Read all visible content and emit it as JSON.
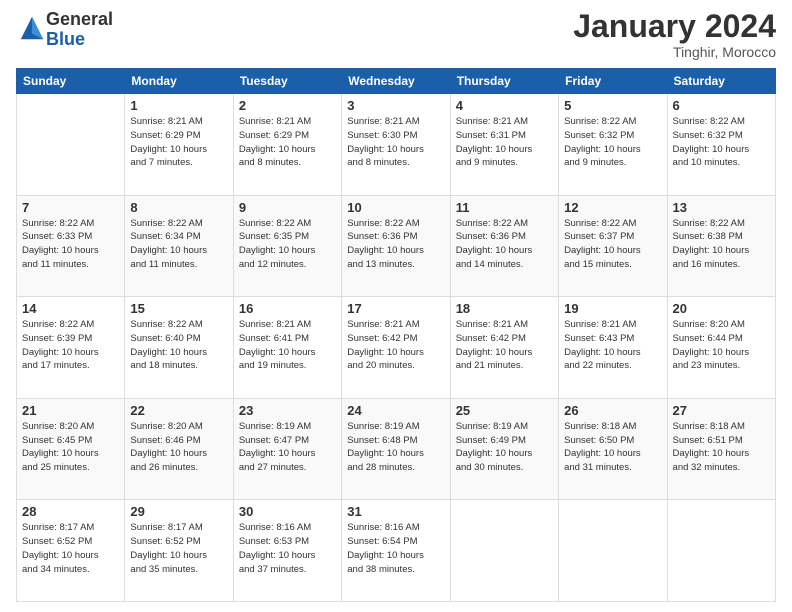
{
  "header": {
    "logo_general": "General",
    "logo_blue": "Blue",
    "month_title": "January 2024",
    "location": "Tinghir, Morocco"
  },
  "calendar": {
    "days_of_week": [
      "Sunday",
      "Monday",
      "Tuesday",
      "Wednesday",
      "Thursday",
      "Friday",
      "Saturday"
    ],
    "weeks": [
      [
        {
          "day": "",
          "info": ""
        },
        {
          "day": "1",
          "info": "Sunrise: 8:21 AM\nSunset: 6:29 PM\nDaylight: 10 hours\nand 7 minutes."
        },
        {
          "day": "2",
          "info": "Sunrise: 8:21 AM\nSunset: 6:29 PM\nDaylight: 10 hours\nand 8 minutes."
        },
        {
          "day": "3",
          "info": "Sunrise: 8:21 AM\nSunset: 6:30 PM\nDaylight: 10 hours\nand 8 minutes."
        },
        {
          "day": "4",
          "info": "Sunrise: 8:21 AM\nSunset: 6:31 PM\nDaylight: 10 hours\nand 9 minutes."
        },
        {
          "day": "5",
          "info": "Sunrise: 8:22 AM\nSunset: 6:32 PM\nDaylight: 10 hours\nand 9 minutes."
        },
        {
          "day": "6",
          "info": "Sunrise: 8:22 AM\nSunset: 6:32 PM\nDaylight: 10 hours\nand 10 minutes."
        }
      ],
      [
        {
          "day": "7",
          "info": "Sunrise: 8:22 AM\nSunset: 6:33 PM\nDaylight: 10 hours\nand 11 minutes."
        },
        {
          "day": "8",
          "info": "Sunrise: 8:22 AM\nSunset: 6:34 PM\nDaylight: 10 hours\nand 11 minutes."
        },
        {
          "day": "9",
          "info": "Sunrise: 8:22 AM\nSunset: 6:35 PM\nDaylight: 10 hours\nand 12 minutes."
        },
        {
          "day": "10",
          "info": "Sunrise: 8:22 AM\nSunset: 6:36 PM\nDaylight: 10 hours\nand 13 minutes."
        },
        {
          "day": "11",
          "info": "Sunrise: 8:22 AM\nSunset: 6:36 PM\nDaylight: 10 hours\nand 14 minutes."
        },
        {
          "day": "12",
          "info": "Sunrise: 8:22 AM\nSunset: 6:37 PM\nDaylight: 10 hours\nand 15 minutes."
        },
        {
          "day": "13",
          "info": "Sunrise: 8:22 AM\nSunset: 6:38 PM\nDaylight: 10 hours\nand 16 minutes."
        }
      ],
      [
        {
          "day": "14",
          "info": "Sunrise: 8:22 AM\nSunset: 6:39 PM\nDaylight: 10 hours\nand 17 minutes."
        },
        {
          "day": "15",
          "info": "Sunrise: 8:22 AM\nSunset: 6:40 PM\nDaylight: 10 hours\nand 18 minutes."
        },
        {
          "day": "16",
          "info": "Sunrise: 8:21 AM\nSunset: 6:41 PM\nDaylight: 10 hours\nand 19 minutes."
        },
        {
          "day": "17",
          "info": "Sunrise: 8:21 AM\nSunset: 6:42 PM\nDaylight: 10 hours\nand 20 minutes."
        },
        {
          "day": "18",
          "info": "Sunrise: 8:21 AM\nSunset: 6:42 PM\nDaylight: 10 hours\nand 21 minutes."
        },
        {
          "day": "19",
          "info": "Sunrise: 8:21 AM\nSunset: 6:43 PM\nDaylight: 10 hours\nand 22 minutes."
        },
        {
          "day": "20",
          "info": "Sunrise: 8:20 AM\nSunset: 6:44 PM\nDaylight: 10 hours\nand 23 minutes."
        }
      ],
      [
        {
          "day": "21",
          "info": "Sunrise: 8:20 AM\nSunset: 6:45 PM\nDaylight: 10 hours\nand 25 minutes."
        },
        {
          "day": "22",
          "info": "Sunrise: 8:20 AM\nSunset: 6:46 PM\nDaylight: 10 hours\nand 26 minutes."
        },
        {
          "day": "23",
          "info": "Sunrise: 8:19 AM\nSunset: 6:47 PM\nDaylight: 10 hours\nand 27 minutes."
        },
        {
          "day": "24",
          "info": "Sunrise: 8:19 AM\nSunset: 6:48 PM\nDaylight: 10 hours\nand 28 minutes."
        },
        {
          "day": "25",
          "info": "Sunrise: 8:19 AM\nSunset: 6:49 PM\nDaylight: 10 hours\nand 30 minutes."
        },
        {
          "day": "26",
          "info": "Sunrise: 8:18 AM\nSunset: 6:50 PM\nDaylight: 10 hours\nand 31 minutes."
        },
        {
          "day": "27",
          "info": "Sunrise: 8:18 AM\nSunset: 6:51 PM\nDaylight: 10 hours\nand 32 minutes."
        }
      ],
      [
        {
          "day": "28",
          "info": "Sunrise: 8:17 AM\nSunset: 6:52 PM\nDaylight: 10 hours\nand 34 minutes."
        },
        {
          "day": "29",
          "info": "Sunrise: 8:17 AM\nSunset: 6:52 PM\nDaylight: 10 hours\nand 35 minutes."
        },
        {
          "day": "30",
          "info": "Sunrise: 8:16 AM\nSunset: 6:53 PM\nDaylight: 10 hours\nand 37 minutes."
        },
        {
          "day": "31",
          "info": "Sunrise: 8:16 AM\nSunset: 6:54 PM\nDaylight: 10 hours\nand 38 minutes."
        },
        {
          "day": "",
          "info": ""
        },
        {
          "day": "",
          "info": ""
        },
        {
          "day": "",
          "info": ""
        }
      ]
    ]
  }
}
